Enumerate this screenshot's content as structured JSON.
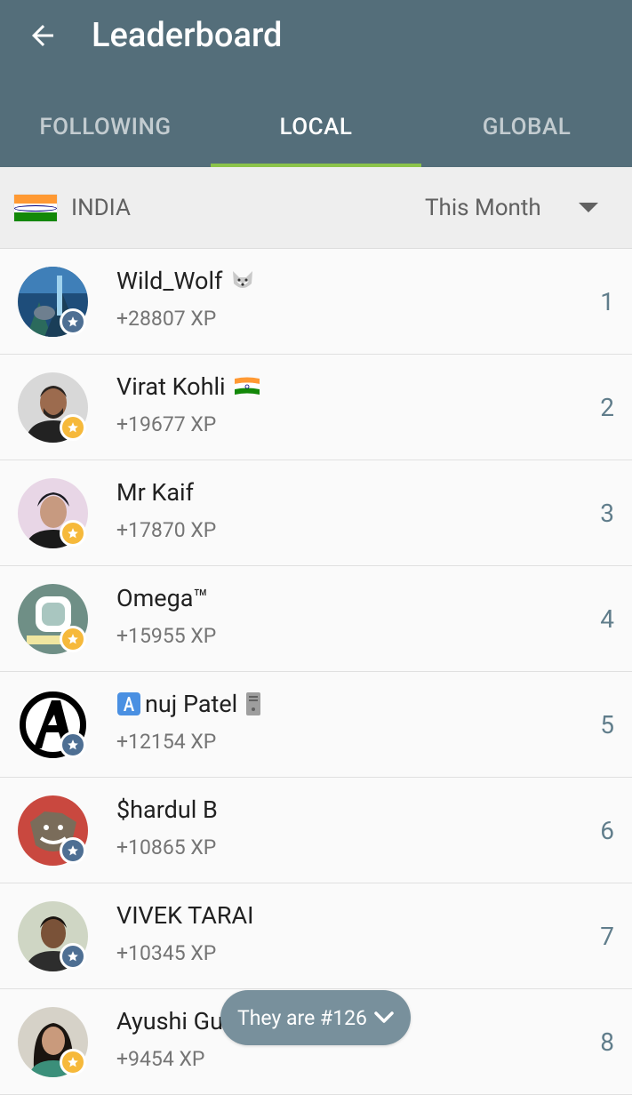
{
  "header": {
    "title": "Leaderboard",
    "back_icon": "arrow-back-icon",
    "background_color": "#546e7a"
  },
  "tabs": [
    {
      "label": "FOLLOWING",
      "active": false
    },
    {
      "label": "LOCAL",
      "active": true
    },
    {
      "label": "GLOBAL",
      "active": false
    }
  ],
  "tab_indicator_color": "#8bc34a",
  "filter": {
    "country": "INDIA",
    "flag_icon": "india-flag-icon",
    "period": "This Month",
    "dropdown_icon": "caret-down-icon"
  },
  "users": [
    {
      "name": "Wild_Wolf",
      "emoji": "wolf-emoji-icon",
      "xp": "+28807 XP",
      "rank": "1",
      "badge": "blue"
    },
    {
      "name": "Virat Kohli",
      "emoji": "india-flag-emoji-icon",
      "xp": "+19677 XP",
      "rank": "2",
      "badge": "gold"
    },
    {
      "name": "Mr Kaif",
      "emoji": "",
      "xp": "+17870 XP",
      "rank": "3",
      "badge": "gold"
    },
    {
      "name": "Omega™",
      "emoji": "",
      "xp": "+15955 XP",
      "rank": "4",
      "badge": "gold"
    },
    {
      "name": "nuj Patel",
      "prefix_emoji": "letter-a-box-emoji-icon",
      "emoji": "computer-emoji-icon",
      "xp": "+12154 XP",
      "rank": "5",
      "badge": "blue"
    },
    {
      "name": "$hardul B",
      "emoji": "",
      "xp": "+10865 XP",
      "rank": "6",
      "badge": "blue"
    },
    {
      "name": "VIVEK TARAI",
      "emoji": "",
      "xp": "+10345 XP",
      "rank": "7",
      "badge": "blue"
    },
    {
      "name": "Ayushi Gu",
      "emoji": "",
      "xp": "+9454 XP",
      "rank": "8",
      "badge": "gold"
    }
  ],
  "badge_colors": {
    "blue": "#4e6f93",
    "gold": "#f6b93b"
  },
  "floating_pill": {
    "label": "They are #126",
    "icon": "chevron-down-icon"
  }
}
